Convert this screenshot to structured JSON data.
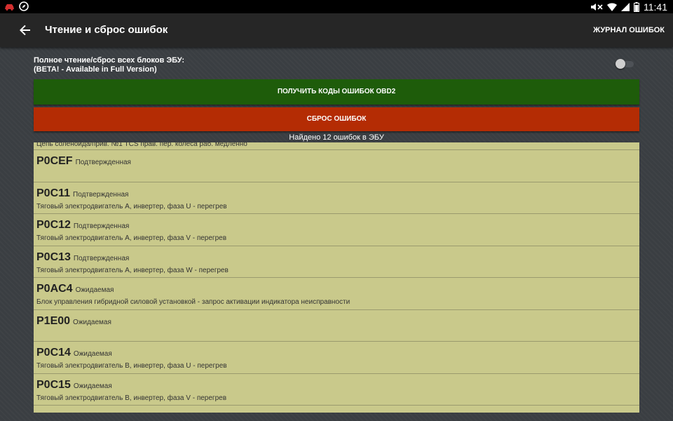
{
  "status_bar": {
    "time": "11:41"
  },
  "app_bar": {
    "title": "Чтение и сброс ошибок",
    "action": "ЖУРНАЛ ОШИБОК"
  },
  "full_read": {
    "line1": "Полное чтение/сброс всех блоков ЭБУ:",
    "line2": "(BETA! - Available in Full Version)",
    "enabled": false
  },
  "buttons": {
    "get_codes": "ПОЛУЧИТЬ КОДЫ ОШИБОК OBD2",
    "reset": "СБРОС ОШИБОК"
  },
  "found_text": "Найдено 12 ошибок в ЭБУ",
  "partial_row_text": "Цепь соленоида/прив. №1 TCS прав. пер. колеса раб. медленно",
  "errors": [
    {
      "code": "P0CEF",
      "status": "Подтвержденная",
      "description": ""
    },
    {
      "code": "P0C11",
      "status": "Подтвержденная",
      "description": "Тяговый электродвигатель A, инвертер, фаза U - перегрев"
    },
    {
      "code": "P0C12",
      "status": "Подтвержденная",
      "description": "Тяговый электродвигатель A, инвертер, фаза V - перегрев"
    },
    {
      "code": "P0C13",
      "status": "Подтвержденная",
      "description": "Тяговый электродвигатель A, инвертер, фаза W - перегрев"
    },
    {
      "code": "P0AC4",
      "status": "Ожидаемая",
      "description": "Блок управления гибридной силовой установкой - запрос активации индикатора неисправности"
    },
    {
      "code": "P1E00",
      "status": "Ожидаемая",
      "description": ""
    },
    {
      "code": "P0C14",
      "status": "Ожидаемая",
      "description": "Тяговый электродвигатель B, инвертер, фаза U - перегрев"
    },
    {
      "code": "P0C15",
      "status": "Ожидаемая",
      "description": "Тяговый электродвигатель B, инвертер, фаза V - перегрев"
    }
  ],
  "colors": {
    "get_button": "#1e5c0a",
    "reset_button": "#b42c04",
    "list_bg": "#c9c98b",
    "app_bar": "#262626"
  },
  "icons": [
    "car-icon",
    "compass-icon",
    "mute-icon",
    "wifi-icon",
    "signal-icon",
    "battery-icon",
    "back-arrow-icon"
  ]
}
